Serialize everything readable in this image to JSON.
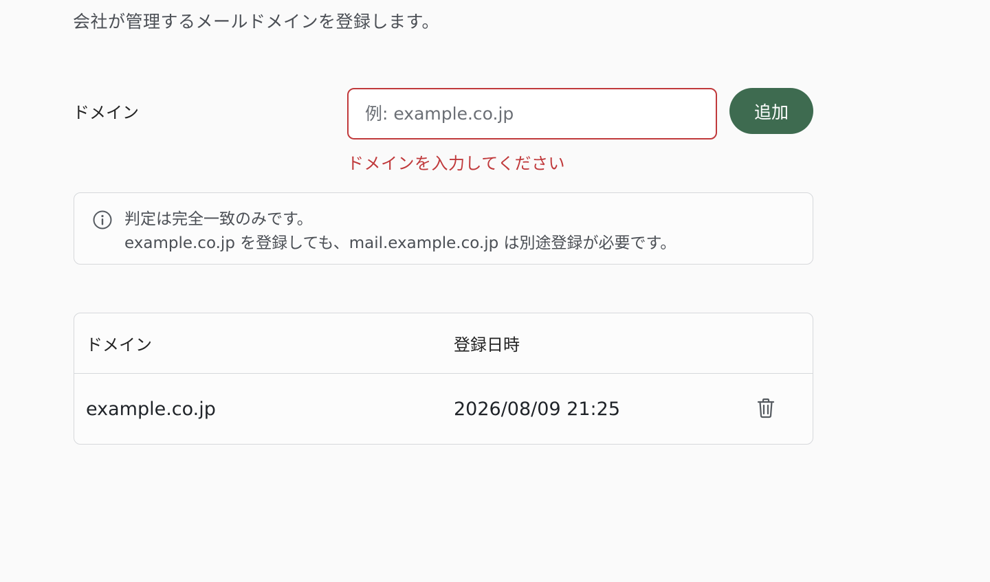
{
  "page": {
    "description": "会社が管理するメールドメインを登録します。"
  },
  "form": {
    "label": "ドメイン",
    "input_placeholder": "例: example.co.jp",
    "input_value": "",
    "add_label": "追加",
    "error_message": "ドメインを入力してください"
  },
  "info": {
    "icon": "info-icon",
    "line1": "判定は完全一致のみです。",
    "line2": "example.co.jp を登録しても、mail.example.co.jp は別途登録が必要です。"
  },
  "table": {
    "headers": {
      "domain": "ドメイン",
      "registered_at": "登録日時"
    },
    "rows": [
      {
        "domain": "example.co.jp",
        "registered_at": "2026/08/09 21:25",
        "action_icon": "trash-icon"
      }
    ]
  },
  "colors": {
    "accent": "#3e6b50",
    "error": "#c0393b",
    "border": "#d6d8db",
    "background": "#fafafa"
  }
}
